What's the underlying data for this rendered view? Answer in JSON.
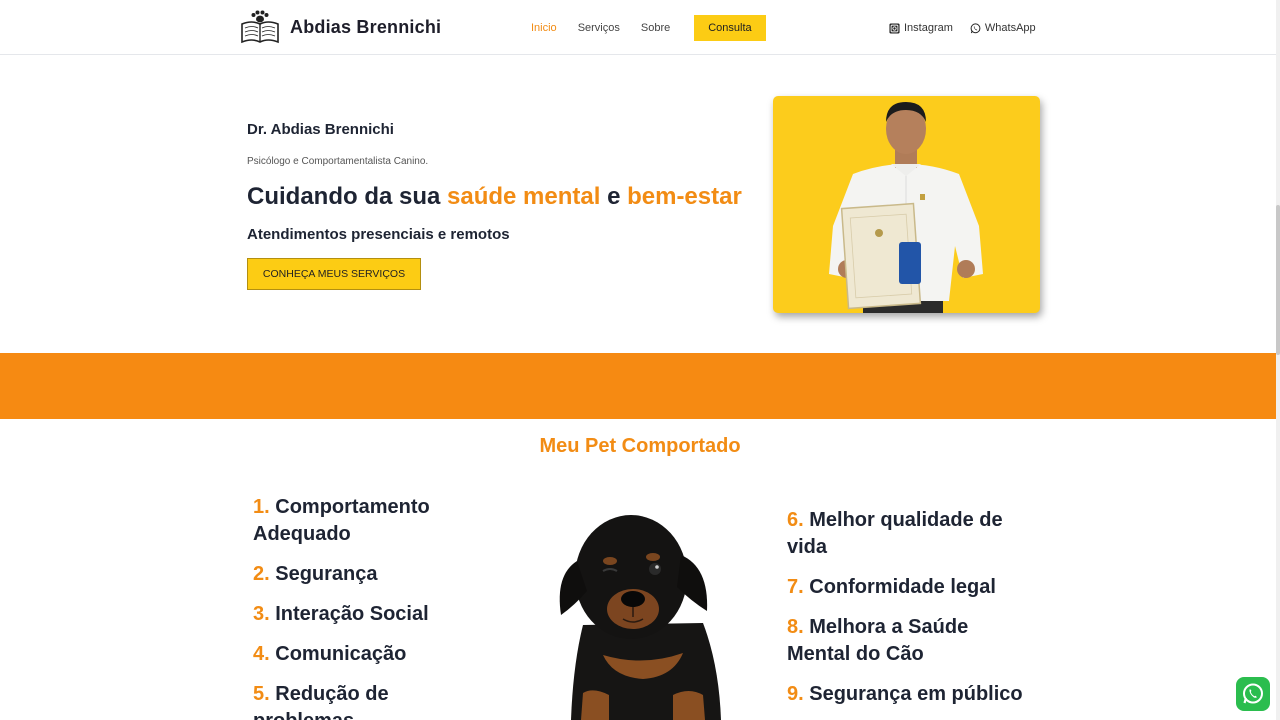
{
  "header": {
    "brand_name": "Abdias Brennichi",
    "nav": [
      {
        "label": "Inicio",
        "active": true
      },
      {
        "label": "Serviços",
        "active": false
      },
      {
        "label": "Sobre",
        "active": false
      }
    ],
    "cta_label": "Consulta",
    "social": [
      {
        "label": "Instagram",
        "icon": "instagram-icon"
      },
      {
        "label": "WhatsApp",
        "icon": "whatsapp-icon"
      }
    ]
  },
  "hero": {
    "name": "Dr. Abdias Brennichi",
    "subtitle": "Psicólogo e Comportamentalista Canino.",
    "title_part1": "Cuidando da sua ",
    "title_hl1": "saúde mental",
    "title_part2": " e ",
    "title_hl2": "bem-estar",
    "tagline": "Atendimentos presenciais e remotos",
    "button_label": "CONHEÇA MEUS SERVIÇOS"
  },
  "section": {
    "title": "Meu Pet Comportado",
    "left_items": [
      {
        "num": "1.",
        "label": "Comportamento Adequado"
      },
      {
        "num": "2.",
        "label": "Segurança"
      },
      {
        "num": "3.",
        "label": "Interação Social"
      },
      {
        "num": "4.",
        "label": "Comunicação"
      },
      {
        "num": "5.",
        "label": "Redução de problemas"
      }
    ],
    "right_items": [
      {
        "num": "6.",
        "label": "Melhor qualidade de vida"
      },
      {
        "num": "7.",
        "label": "Conformidade legal"
      },
      {
        "num": "8.",
        "label": "Melhora a Saúde Mental do Cão"
      },
      {
        "num": "9.",
        "label": "Segurança em público"
      }
    ]
  },
  "colors": {
    "accent": "#f28c14",
    "yellow": "#fccc14",
    "band": "#f68a12",
    "text": "#1e2433",
    "whatsapp": "#2bbd4e"
  }
}
